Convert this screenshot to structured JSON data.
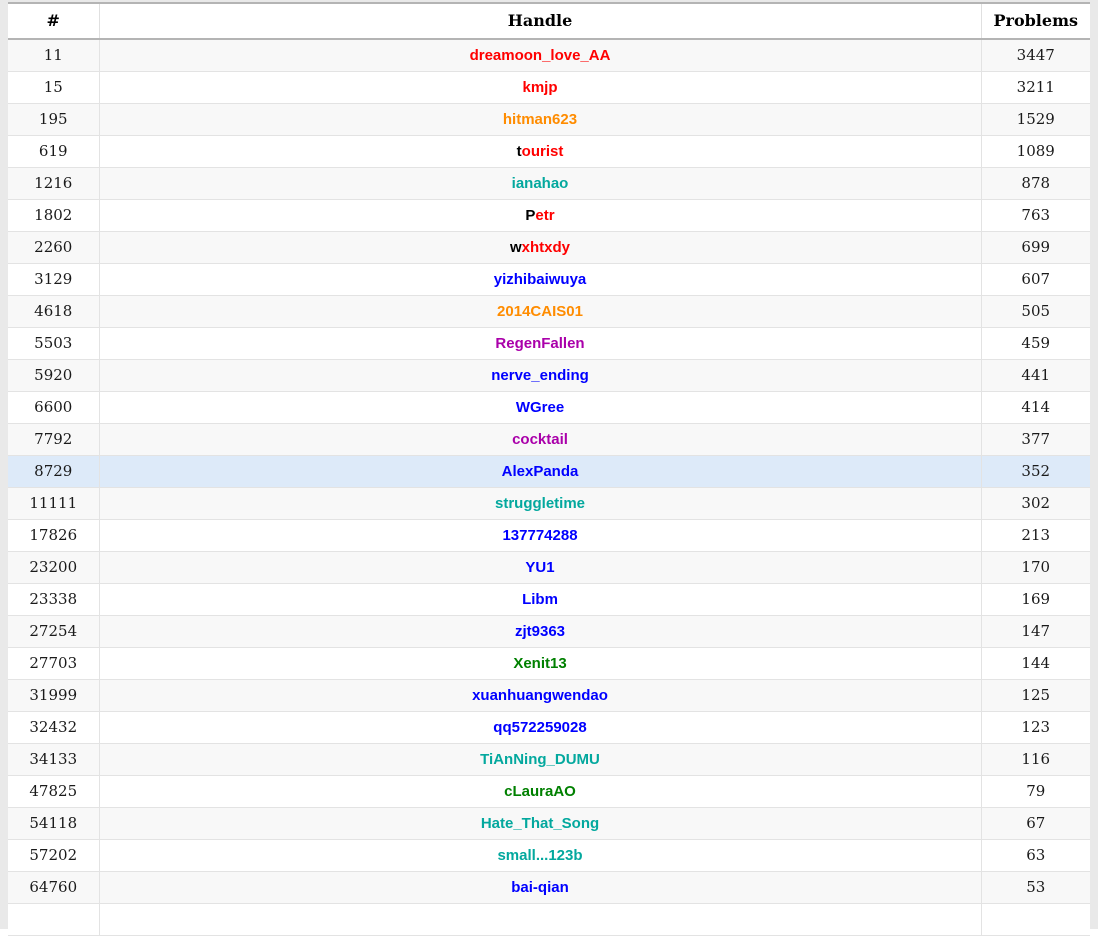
{
  "table": {
    "columns": [
      {
        "key": "rank",
        "label": "#"
      },
      {
        "key": "handle",
        "label": "Handle"
      },
      {
        "key": "problems",
        "label": "Problems"
      }
    ],
    "rank_colors": {
      "legendary_grandmaster": "#ff0000",
      "international_grandmaster": "#ff0000",
      "grandmaster": "#ff0000",
      "master": "#ff8c00",
      "candidate_master": "#aa00aa",
      "expert": "#0000ff",
      "specialist": "#03a89e",
      "pupil": "#008000",
      "newbie": "#808080"
    },
    "highlight_color": "#ddeaf9",
    "rows": [
      {
        "rank": "11",
        "handle": "dreamoon_love_AA",
        "first_letter_black": false,
        "color": "#ff0000",
        "problems": "3447",
        "highlighted": false
      },
      {
        "rank": "15",
        "handle": "kmjp",
        "first_letter_black": false,
        "color": "#ff0000",
        "problems": "3211",
        "highlighted": false
      },
      {
        "rank": "195",
        "handle": "hitman623",
        "first_letter_black": false,
        "color": "#ff8c00",
        "problems": "1529",
        "highlighted": false
      },
      {
        "rank": "619",
        "handle": "tourist",
        "first_letter_black": true,
        "color": "#ff0000",
        "problems": "1089",
        "highlighted": false
      },
      {
        "rank": "1216",
        "handle": "ianahao",
        "first_letter_black": false,
        "color": "#03a89e",
        "problems": "878",
        "highlighted": false
      },
      {
        "rank": "1802",
        "handle": "Petr",
        "first_letter_black": true,
        "color": "#ff0000",
        "problems": "763",
        "highlighted": false
      },
      {
        "rank": "2260",
        "handle": "wxhtxdy",
        "first_letter_black": true,
        "color": "#ff0000",
        "problems": "699",
        "highlighted": false
      },
      {
        "rank": "3129",
        "handle": "yizhibaiwuya",
        "first_letter_black": false,
        "color": "#0000ff",
        "problems": "607",
        "highlighted": false
      },
      {
        "rank": "4618",
        "handle": "2014CAIS01",
        "first_letter_black": false,
        "color": "#ff8c00",
        "problems": "505",
        "highlighted": false
      },
      {
        "rank": "5503",
        "handle": "RegenFallen",
        "first_letter_black": false,
        "color": "#aa00aa",
        "problems": "459",
        "highlighted": false
      },
      {
        "rank": "5920",
        "handle": "nerve_ending",
        "first_letter_black": false,
        "color": "#0000ff",
        "problems": "441",
        "highlighted": false
      },
      {
        "rank": "6600",
        "handle": "WGree",
        "first_letter_black": false,
        "color": "#0000ff",
        "problems": "414",
        "highlighted": false
      },
      {
        "rank": "7792",
        "handle": "cocktail",
        "first_letter_black": false,
        "color": "#aa00aa",
        "problems": "377",
        "highlighted": false
      },
      {
        "rank": "8729",
        "handle": "AlexPanda",
        "first_letter_black": false,
        "color": "#0000ff",
        "problems": "352",
        "highlighted": true
      },
      {
        "rank": "11111",
        "handle": "struggletime",
        "first_letter_black": false,
        "color": "#03a89e",
        "problems": "302",
        "highlighted": false
      },
      {
        "rank": "17826",
        "handle": "137774288",
        "first_letter_black": false,
        "color": "#0000ff",
        "problems": "213",
        "highlighted": false
      },
      {
        "rank": "23200",
        "handle": "YU1",
        "first_letter_black": false,
        "color": "#0000ff",
        "problems": "170",
        "highlighted": false
      },
      {
        "rank": "23338",
        "handle": "Libm",
        "first_letter_black": false,
        "color": "#0000ff",
        "problems": "169",
        "highlighted": false
      },
      {
        "rank": "27254",
        "handle": "zjt9363",
        "first_letter_black": false,
        "color": "#0000ff",
        "problems": "147",
        "highlighted": false
      },
      {
        "rank": "27703",
        "handle": "Xenit13",
        "first_letter_black": false,
        "color": "#008000",
        "problems": "144",
        "highlighted": false
      },
      {
        "rank": "31999",
        "handle": "xuanhuangwendao",
        "first_letter_black": false,
        "color": "#0000ff",
        "problems": "125",
        "highlighted": false
      },
      {
        "rank": "32432",
        "handle": "qq572259028",
        "first_letter_black": false,
        "color": "#0000ff",
        "problems": "123",
        "highlighted": false
      },
      {
        "rank": "34133",
        "handle": "TiAnNing_DUMU",
        "first_letter_black": false,
        "color": "#03a89e",
        "problems": "116",
        "highlighted": false
      },
      {
        "rank": "47825",
        "handle": "cLauraAO",
        "first_letter_black": false,
        "color": "#008000",
        "problems": "79",
        "highlighted": false
      },
      {
        "rank": "54118",
        "handle": "Hate_That_Song",
        "first_letter_black": false,
        "color": "#03a89e",
        "problems": "67",
        "highlighted": false
      },
      {
        "rank": "57202",
        "handle": "small...123b",
        "first_letter_black": false,
        "color": "#03a89e",
        "problems": "63",
        "highlighted": false
      },
      {
        "rank": "64760",
        "handle": "bai-qian",
        "first_letter_black": false,
        "color": "#0000ff",
        "problems": "53",
        "highlighted": false
      },
      {
        "rank": "",
        "handle": "",
        "first_letter_black": false,
        "color": "#0000ff",
        "problems": "",
        "highlighted": false
      }
    ]
  }
}
